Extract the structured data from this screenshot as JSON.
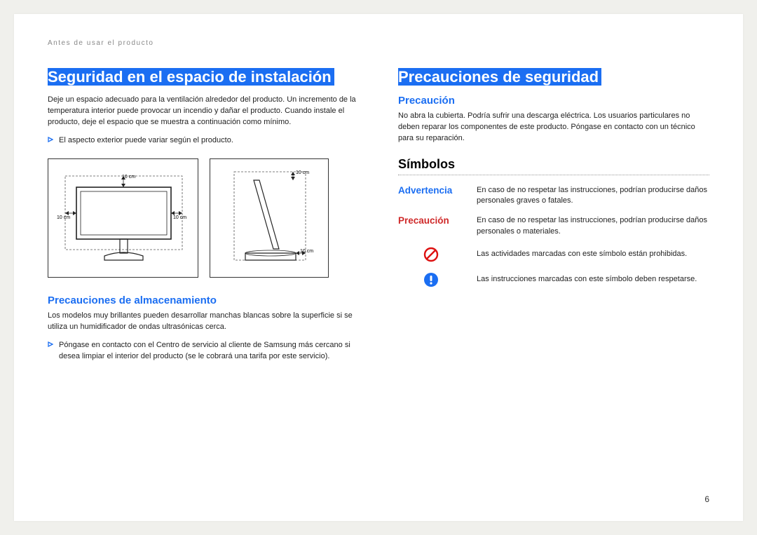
{
  "header_crumb": "Antes de usar el producto",
  "page_number": "6",
  "left": {
    "title": "Seguridad en el espacio de instalación",
    "intro": "Deje un espacio adecuado para la ventilación alrededor del producto. Un incremento de la temperatura interior puede provocar un incendio y dañar el producto. Cuando instale el producto, deje el espacio que se muestra a continuación como mínimo.",
    "bullet1": "El aspecto exterior puede variar según el producto.",
    "fig": {
      "label_top": "10 cm",
      "label_left": "10 cm",
      "label_right": "10 cm",
      "label_side_top": "10 cm",
      "label_side_bottom": "10 cm"
    },
    "sub_heading": "Precauciones de almacenamiento",
    "sub_body": "Los modelos muy brillantes pueden desarrollar manchas blancas sobre la superficie si se utiliza un humidificador de ondas ultrasónicas cerca.",
    "sub_bullet": "Póngase en contacto con el Centro de servicio al cliente de Samsung más cercano si desea limpiar el interior del producto (se le cobrará una tarifa por este servicio)."
  },
  "right": {
    "title": "Precauciones de seguridad",
    "precaution_heading": "Precaución",
    "precaution_body": "No abra la cubierta. Podría sufrir una descarga eléctrica. Los usuarios particulares no deben reparar los componentes de este producto. Póngase en contacto con un técnico para su reparación.",
    "symbols_heading": "Símbolos",
    "rows": {
      "warn_label": "Advertencia",
      "warn_text": "En caso de no respetar las instrucciones, podrían producirse daños personales graves o fatales.",
      "caution_label": "Precaución",
      "caution_text": "En caso de no respetar las instrucciones, podrían producirse daños personales o materiales.",
      "prohibit_text": "Las actividades marcadas con este símbolo están prohibidas.",
      "mandatory_text": "Las instrucciones marcadas con este símbolo deben respetarse."
    }
  }
}
